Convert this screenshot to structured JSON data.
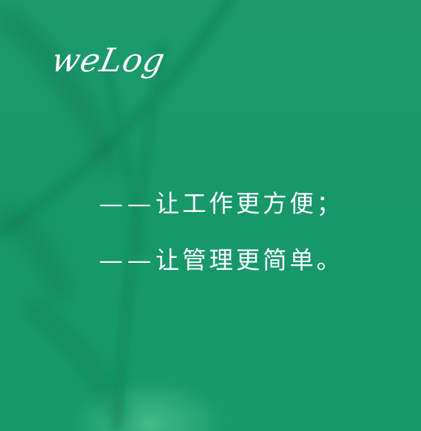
{
  "brand": {
    "logo_text": "weLog"
  },
  "slogan": {
    "line1": {
      "dash": "——",
      "text": "让工作更方便；"
    },
    "line2": {
      "dash": "——",
      "text": "让管理更简单。"
    }
  },
  "colors": {
    "background": "#17986a",
    "text": "#ffffff"
  }
}
